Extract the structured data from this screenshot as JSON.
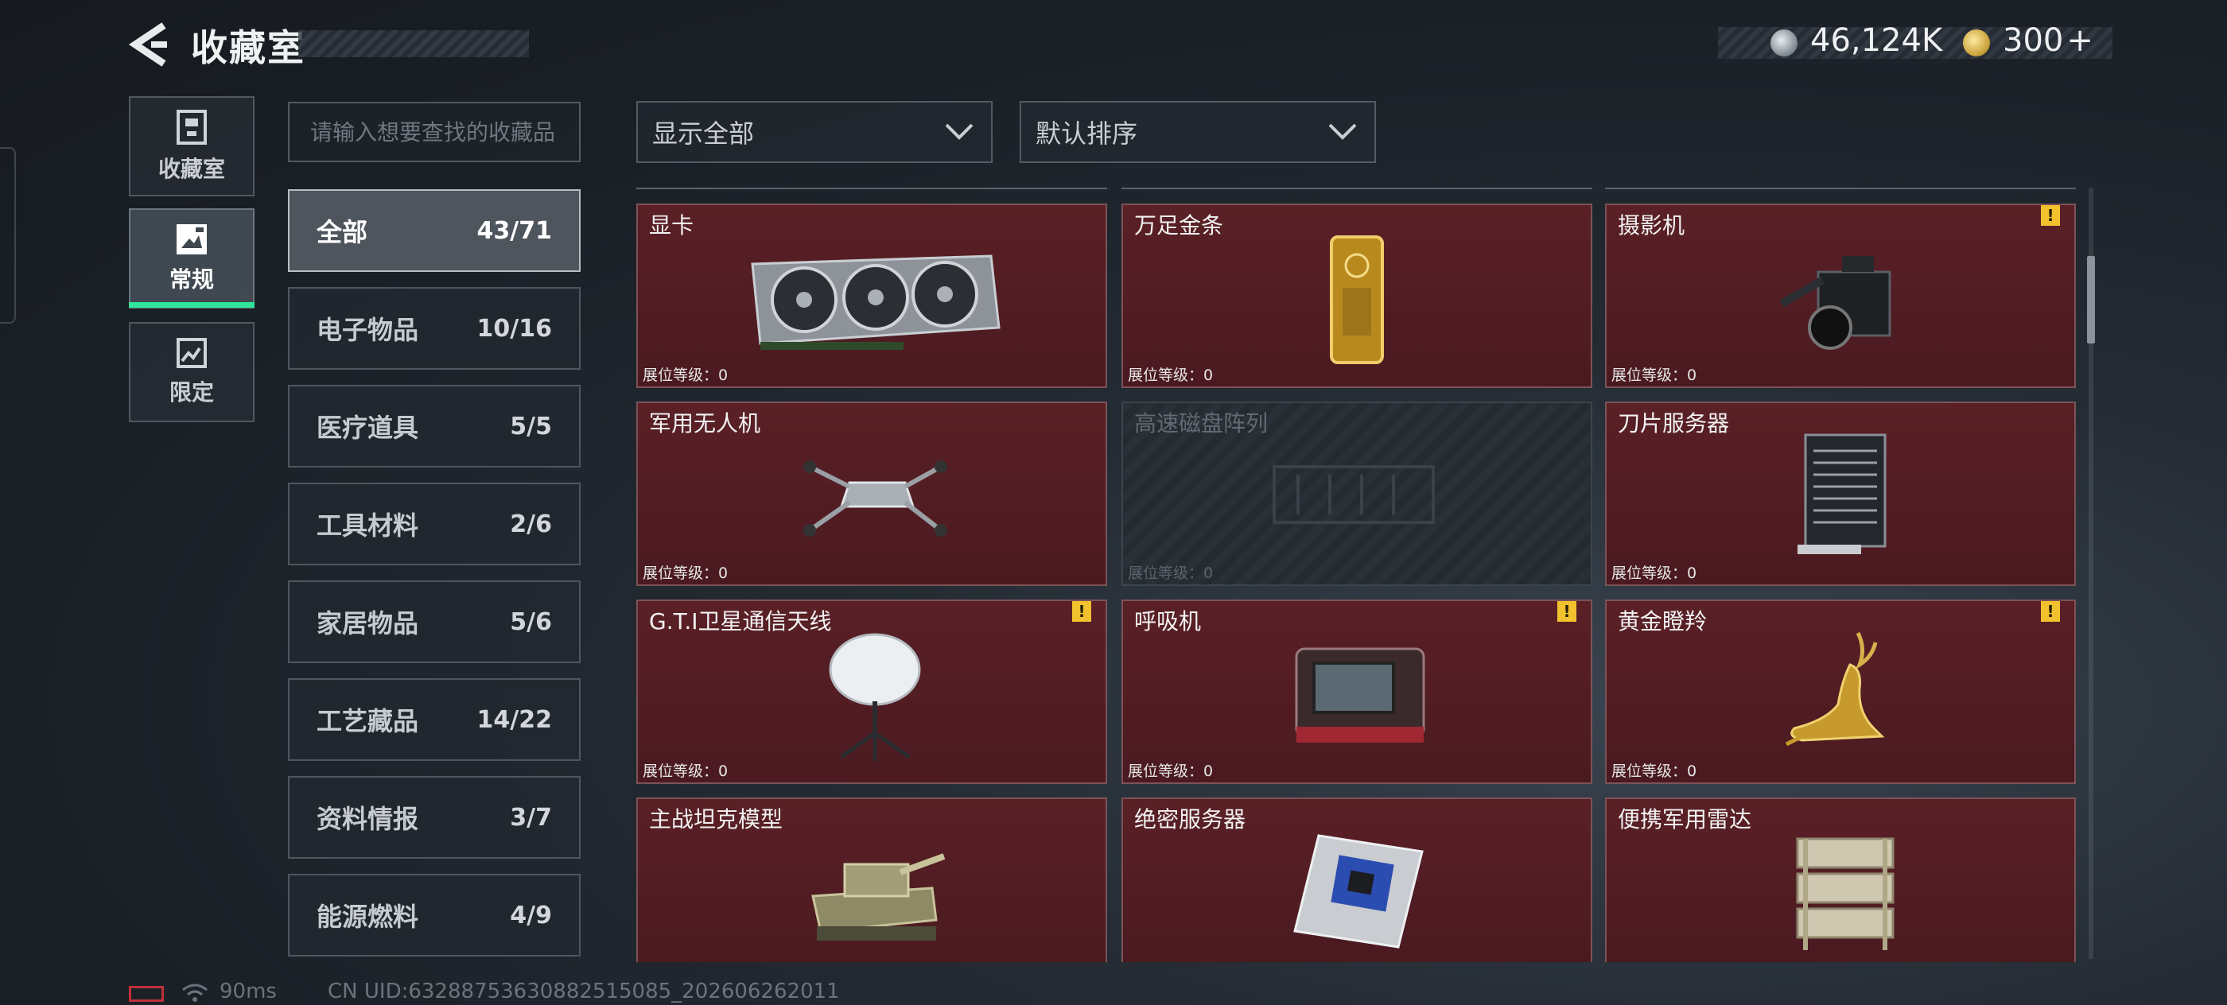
{
  "header": {
    "title": "收藏室",
    "coins": "46,124K",
    "gems": "300",
    "add_label": "+"
  },
  "nav": [
    {
      "label": "收藏室",
      "icon": "storage-box-icon"
    },
    {
      "label": "常规",
      "icon": "picture-frame-icon",
      "active": true
    },
    {
      "label": "限定",
      "icon": "limited-frame-icon"
    }
  ],
  "search": {
    "placeholder": "请输入想要查找的收藏品"
  },
  "filters": {
    "show": "显示全部",
    "sort": "默认排序"
  },
  "categories": [
    {
      "name": "全部",
      "count": "43/71",
      "active": true
    },
    {
      "name": "电子物品",
      "count": "10/16"
    },
    {
      "name": "医疗道具",
      "count": "5/5"
    },
    {
      "name": "工具材料",
      "count": "2/6"
    },
    {
      "name": "家居物品",
      "count": "5/6"
    },
    {
      "name": "工艺藏品",
      "count": "14/22"
    },
    {
      "name": "资料情报",
      "count": "3/7"
    },
    {
      "name": "能源燃料",
      "count": "4/9"
    }
  ],
  "items": [
    {
      "name": "显卡",
      "level": "展位等级：0",
      "art": "gpu-icon"
    },
    {
      "name": "万足金条",
      "level": "展位等级：0",
      "art": "gold-bar-icon"
    },
    {
      "name": "摄影机",
      "level": "展位等级：0",
      "art": "camera-icon",
      "warn": "!"
    },
    {
      "name": "军用无人机",
      "level": "展位等级：0",
      "art": "drone-icon"
    },
    {
      "name": "高速磁盘阵列",
      "level": "展位等级：0",
      "art": "disk-array-icon",
      "locked": true
    },
    {
      "name": "刀片服务器",
      "level": "展位等级：0",
      "art": "blade-server-icon"
    },
    {
      "name": "G.T.I卫星通信天线",
      "level": "展位等级：0",
      "art": "satellite-dish-icon",
      "warn": "!"
    },
    {
      "name": "呼吸机",
      "level": "展位等级：0",
      "art": "ventilator-icon",
      "warn": "!"
    },
    {
      "name": "黄金瞪羚",
      "level": "展位等级：0",
      "art": "golden-gazelle-icon",
      "warn": "!"
    },
    {
      "name": "主战坦克模型",
      "art": "tank-model-icon"
    },
    {
      "name": "绝密服务器",
      "art": "server-board-icon"
    },
    {
      "name": "便携军用雷达",
      "art": "radar-icon"
    }
  ],
  "footer": {
    "ping": "90ms",
    "uid": "CN UID:632887536308825150​85_202606262011"
  },
  "colors": {
    "accent_green": "#2ee59a",
    "card_red": "#5a2026",
    "warn_yellow": "#f2c12e"
  }
}
